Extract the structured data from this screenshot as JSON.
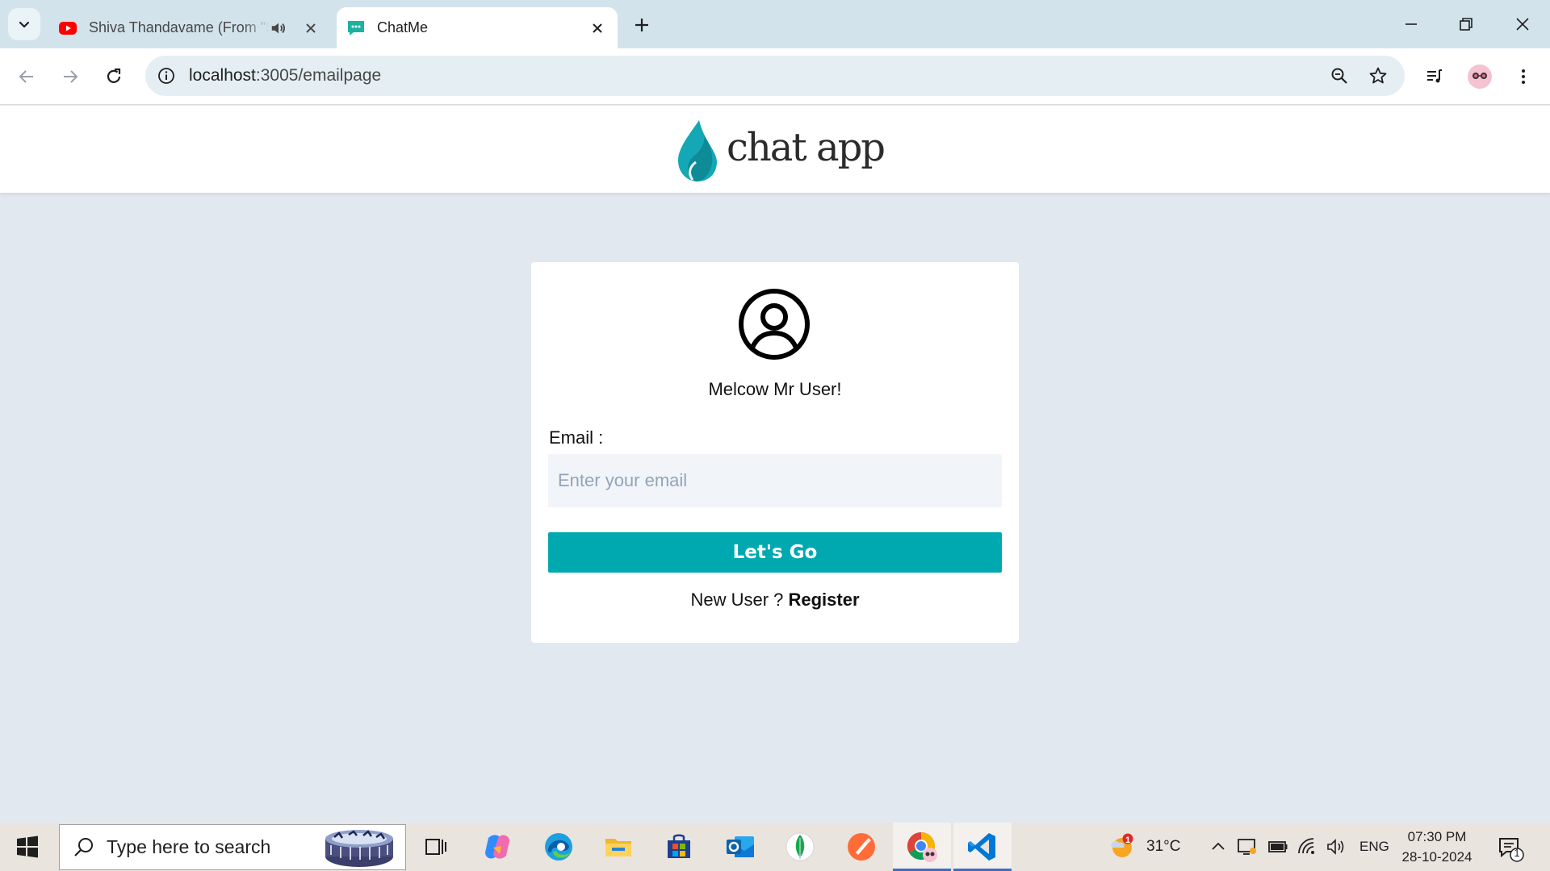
{
  "browser": {
    "tabs": [
      {
        "title": "Shiva Thandavame (From \"S",
        "favicon": "youtube-icon",
        "audio": true
      },
      {
        "title": "ChatMe",
        "favicon": "chat-bubble-icon",
        "audio": false
      }
    ],
    "url_host": "localhost",
    "url_path": ":3005/emailpage"
  },
  "page": {
    "logo_text": "chat app",
    "welcome": "Melcow Mr User!",
    "email_label": "Email :",
    "email_placeholder": "Enter your email",
    "submit_label": "Let's Go",
    "new_user_text": "New User ?",
    "register_label": "Register"
  },
  "taskbar": {
    "search_placeholder": "Type here to search",
    "weather_temp": "31°C",
    "weather_badge": "1",
    "language": "ENG",
    "time": "07:30 PM",
    "date": "28-10-2024",
    "notification_count": "1"
  },
  "colors": {
    "accent": "#00a8b0",
    "page_bg": "#e2e8f0",
    "tabstrip_bg": "#d2e3ec"
  }
}
